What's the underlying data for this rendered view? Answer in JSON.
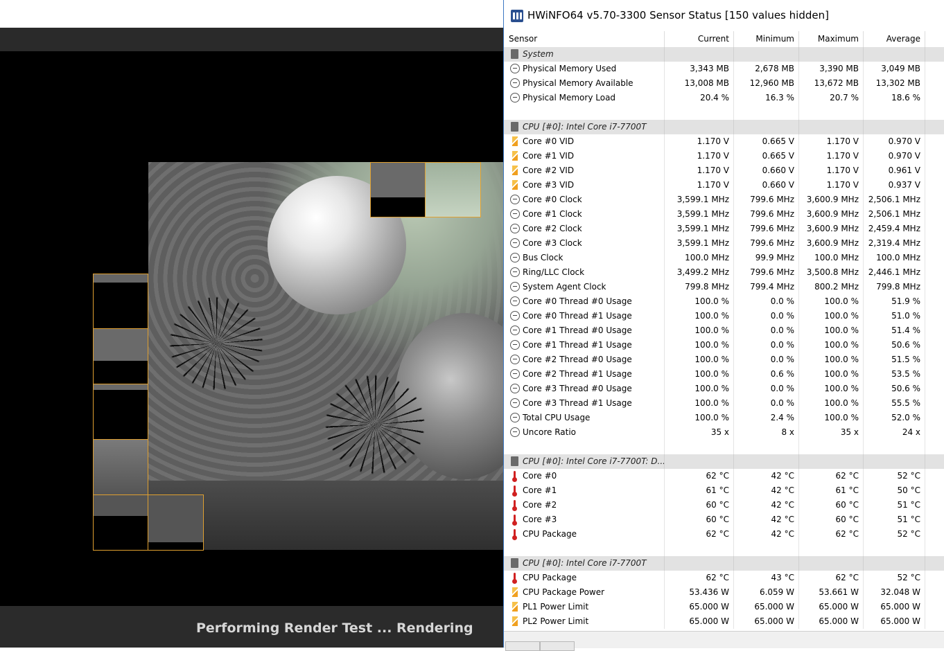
{
  "render": {
    "status": "Performing Render Test ... Rendering"
  },
  "hwinfo": {
    "title": "HWiNFO64 v5.70-3300 Sensor Status [150 values hidden]",
    "columns": {
      "sensor": "Sensor",
      "current": "Current",
      "minimum": "Minimum",
      "maximum": "Maximum",
      "average": "Average"
    },
    "rows": [
      {
        "kind": "group",
        "icon": "chip-icon",
        "name": "System"
      },
      {
        "kind": "data",
        "icon": "clock-icon",
        "name": "Physical Memory Used",
        "current": "3,343 MB",
        "min": "2,678 MB",
        "max": "3,390 MB",
        "avg": "3,049 MB"
      },
      {
        "kind": "data",
        "icon": "clock-icon",
        "name": "Physical Memory Available",
        "current": "13,008 MB",
        "min": "12,960 MB",
        "max": "13,672 MB",
        "avg": "13,302 MB"
      },
      {
        "kind": "data",
        "icon": "clock-icon",
        "name": "Physical Memory Load",
        "current": "20.4 %",
        "min": "16.3 %",
        "max": "20.7 %",
        "avg": "18.6 %"
      },
      {
        "kind": "blank"
      },
      {
        "kind": "group",
        "icon": "chip-icon",
        "name": "CPU [#0]: Intel Core i7-7700T"
      },
      {
        "kind": "data",
        "icon": "voltage-icon",
        "name": "Core #0 VID",
        "current": "1.170 V",
        "min": "0.665 V",
        "max": "1.170 V",
        "avg": "0.970 V"
      },
      {
        "kind": "data",
        "icon": "voltage-icon",
        "name": "Core #1 VID",
        "current": "1.170 V",
        "min": "0.665 V",
        "max": "1.170 V",
        "avg": "0.970 V"
      },
      {
        "kind": "data",
        "icon": "voltage-icon",
        "name": "Core #2 VID",
        "current": "1.170 V",
        "min": "0.660 V",
        "max": "1.170 V",
        "avg": "0.961 V"
      },
      {
        "kind": "data",
        "icon": "voltage-icon",
        "name": "Core #3 VID",
        "current": "1.170 V",
        "min": "0.660 V",
        "max": "1.170 V",
        "avg": "0.937 V"
      },
      {
        "kind": "data",
        "icon": "clock-icon",
        "name": "Core #0 Clock",
        "current": "3,599.1 MHz",
        "min": "799.6 MHz",
        "max": "3,600.9 MHz",
        "avg": "2,506.1 MHz"
      },
      {
        "kind": "data",
        "icon": "clock-icon",
        "name": "Core #1 Clock",
        "current": "3,599.1 MHz",
        "min": "799.6 MHz",
        "max": "3,600.9 MHz",
        "avg": "2,506.1 MHz"
      },
      {
        "kind": "data",
        "icon": "clock-icon",
        "name": "Core #2 Clock",
        "current": "3,599.1 MHz",
        "min": "799.6 MHz",
        "max": "3,600.9 MHz",
        "avg": "2,459.4 MHz"
      },
      {
        "kind": "data",
        "icon": "clock-icon",
        "name": "Core #3 Clock",
        "current": "3,599.1 MHz",
        "min": "799.6 MHz",
        "max": "3,600.9 MHz",
        "avg": "2,319.4 MHz"
      },
      {
        "kind": "data",
        "icon": "clock-icon",
        "name": "Bus Clock",
        "current": "100.0 MHz",
        "min": "99.9 MHz",
        "max": "100.0 MHz",
        "avg": "100.0 MHz"
      },
      {
        "kind": "data",
        "icon": "clock-icon",
        "name": "Ring/LLC Clock",
        "current": "3,499.2 MHz",
        "min": "799.6 MHz",
        "max": "3,500.8 MHz",
        "avg": "2,446.1 MHz"
      },
      {
        "kind": "data",
        "icon": "clock-icon",
        "name": "System Agent Clock",
        "current": "799.8 MHz",
        "min": "799.4 MHz",
        "max": "800.2 MHz",
        "avg": "799.8 MHz"
      },
      {
        "kind": "data",
        "icon": "clock-icon",
        "name": "Core #0 Thread #0 Usage",
        "current": "100.0 %",
        "min": "0.0 %",
        "max": "100.0 %",
        "avg": "51.9 %"
      },
      {
        "kind": "data",
        "icon": "clock-icon",
        "name": "Core #0 Thread #1 Usage",
        "current": "100.0 %",
        "min": "0.0 %",
        "max": "100.0 %",
        "avg": "51.0 %"
      },
      {
        "kind": "data",
        "icon": "clock-icon",
        "name": "Core #1 Thread #0 Usage",
        "current": "100.0 %",
        "min": "0.0 %",
        "max": "100.0 %",
        "avg": "51.4 %"
      },
      {
        "kind": "data",
        "icon": "clock-icon",
        "name": "Core #1 Thread #1 Usage",
        "current": "100.0 %",
        "min": "0.0 %",
        "max": "100.0 %",
        "avg": "50.6 %"
      },
      {
        "kind": "data",
        "icon": "clock-icon",
        "name": "Core #2 Thread #0 Usage",
        "current": "100.0 %",
        "min": "0.0 %",
        "max": "100.0 %",
        "avg": "51.5 %"
      },
      {
        "kind": "data",
        "icon": "clock-icon",
        "name": "Core #2 Thread #1 Usage",
        "current": "100.0 %",
        "min": "0.6 %",
        "max": "100.0 %",
        "avg": "53.5 %"
      },
      {
        "kind": "data",
        "icon": "clock-icon",
        "name": "Core #3 Thread #0 Usage",
        "current": "100.0 %",
        "min": "0.0 %",
        "max": "100.0 %",
        "avg": "50.6 %"
      },
      {
        "kind": "data",
        "icon": "clock-icon",
        "name": "Core #3 Thread #1 Usage",
        "current": "100.0 %",
        "min": "0.0 %",
        "max": "100.0 %",
        "avg": "55.5 %"
      },
      {
        "kind": "data",
        "icon": "clock-icon",
        "name": "Total CPU Usage",
        "current": "100.0 %",
        "min": "2.4 %",
        "max": "100.0 %",
        "avg": "52.0 %"
      },
      {
        "kind": "data",
        "icon": "clock-icon",
        "name": "Uncore Ratio",
        "current": "35 x",
        "min": "8 x",
        "max": "35 x",
        "avg": "24 x"
      },
      {
        "kind": "blank"
      },
      {
        "kind": "group",
        "icon": "chip-icon",
        "name": "CPU [#0]: Intel Core i7-7700T: D..."
      },
      {
        "kind": "data",
        "icon": "thermometer-icon",
        "name": "Core #0",
        "current": "62 °C",
        "min": "42 °C",
        "max": "62 °C",
        "avg": "52 °C"
      },
      {
        "kind": "data",
        "icon": "thermometer-icon",
        "name": "Core #1",
        "current": "61 °C",
        "min": "42 °C",
        "max": "61 °C",
        "avg": "50 °C"
      },
      {
        "kind": "data",
        "icon": "thermometer-icon",
        "name": "Core #2",
        "current": "60 °C",
        "min": "42 °C",
        "max": "60 °C",
        "avg": "51 °C"
      },
      {
        "kind": "data",
        "icon": "thermometer-icon",
        "name": "Core #3",
        "current": "60 °C",
        "min": "42 °C",
        "max": "60 °C",
        "avg": "51 °C"
      },
      {
        "kind": "data",
        "icon": "thermometer-icon",
        "name": "CPU Package",
        "current": "62 °C",
        "min": "42 °C",
        "max": "62 °C",
        "avg": "52 °C"
      },
      {
        "kind": "blank"
      },
      {
        "kind": "group",
        "icon": "chip-icon",
        "name": "CPU [#0]: Intel Core i7-7700T"
      },
      {
        "kind": "data",
        "icon": "thermometer-icon",
        "name": "CPU Package",
        "current": "62 °C",
        "min": "43 °C",
        "max": "62 °C",
        "avg": "52 °C"
      },
      {
        "kind": "data",
        "icon": "voltage-icon",
        "name": "CPU Package Power",
        "current": "53.436 W",
        "min": "6.059 W",
        "max": "53.661 W",
        "avg": "32.048 W"
      },
      {
        "kind": "data",
        "icon": "voltage-icon",
        "name": "PL1 Power Limit",
        "current": "65.000 W",
        "min": "65.000 W",
        "max": "65.000 W",
        "avg": "65.000 W"
      },
      {
        "kind": "data",
        "icon": "voltage-icon",
        "name": "PL2 Power Limit",
        "current": "65.000 W",
        "min": "65.000 W",
        "max": "65.000 W",
        "avg": "65.000 W"
      }
    ]
  }
}
